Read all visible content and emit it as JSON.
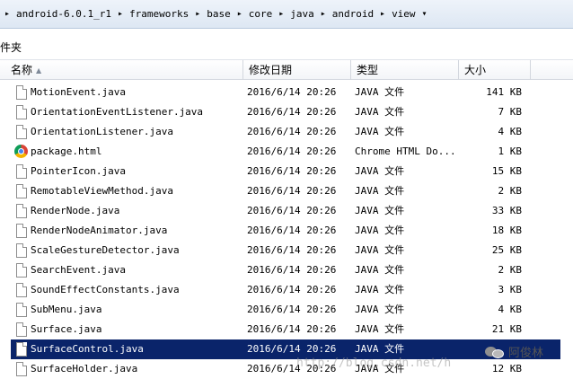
{
  "breadcrumb": [
    "android-6.0.1_r1",
    "frameworks",
    "base",
    "core",
    "java",
    "android",
    "view"
  ],
  "toolbar": {
    "label": "件夹"
  },
  "columns": {
    "name": "名称",
    "date": "修改日期",
    "type": "类型",
    "size": "大小"
  },
  "files": [
    {
      "name": "MotionEvent.java",
      "date": "2016/6/14 20:26",
      "type": "JAVA 文件",
      "size": "141 KB",
      "icon": "java-file-icon"
    },
    {
      "name": "OrientationEventListener.java",
      "date": "2016/6/14 20:26",
      "type": "JAVA 文件",
      "size": "7 KB",
      "icon": "java-file-icon"
    },
    {
      "name": "OrientationListener.java",
      "date": "2016/6/14 20:26",
      "type": "JAVA 文件",
      "size": "4 KB",
      "icon": "java-file-icon"
    },
    {
      "name": "package.html",
      "date": "2016/6/14 20:26",
      "type": "Chrome HTML Do...",
      "size": "1 KB",
      "icon": "chrome-icon"
    },
    {
      "name": "PointerIcon.java",
      "date": "2016/6/14 20:26",
      "type": "JAVA 文件",
      "size": "15 KB",
      "icon": "java-file-icon"
    },
    {
      "name": "RemotableViewMethod.java",
      "date": "2016/6/14 20:26",
      "type": "JAVA 文件",
      "size": "2 KB",
      "icon": "java-file-icon"
    },
    {
      "name": "RenderNode.java",
      "date": "2016/6/14 20:26",
      "type": "JAVA 文件",
      "size": "33 KB",
      "icon": "java-file-icon"
    },
    {
      "name": "RenderNodeAnimator.java",
      "date": "2016/6/14 20:26",
      "type": "JAVA 文件",
      "size": "18 KB",
      "icon": "java-file-icon"
    },
    {
      "name": "ScaleGestureDetector.java",
      "date": "2016/6/14 20:26",
      "type": "JAVA 文件",
      "size": "25 KB",
      "icon": "java-file-icon"
    },
    {
      "name": "SearchEvent.java",
      "date": "2016/6/14 20:26",
      "type": "JAVA 文件",
      "size": "2 KB",
      "icon": "java-file-icon"
    },
    {
      "name": "SoundEffectConstants.java",
      "date": "2016/6/14 20:26",
      "type": "JAVA 文件",
      "size": "3 KB",
      "icon": "java-file-icon"
    },
    {
      "name": "SubMenu.java",
      "date": "2016/6/14 20:26",
      "type": "JAVA 文件",
      "size": "4 KB",
      "icon": "java-file-icon"
    },
    {
      "name": "Surface.java",
      "date": "2016/6/14 20:26",
      "type": "JAVA 文件",
      "size": "21 KB",
      "icon": "java-file-icon"
    },
    {
      "name": "SurfaceControl.java",
      "date": "2016/6/14 20:26",
      "type": "JAVA 文件",
      "size": "",
      "icon": "java-file-icon",
      "selected": true
    },
    {
      "name": "SurfaceHolder.java",
      "date": "2016/6/14 20:26",
      "type": "JAVA 文件",
      "size": "12 KB",
      "icon": "java-file-icon"
    }
  ],
  "watermark": {
    "url": "http://blog.csdn.net/h",
    "brand": "阿俊林"
  },
  "colors": {
    "selection": "#0a246a",
    "header_bg": "#f3f5f8",
    "address_bg": "#dde7f3"
  }
}
